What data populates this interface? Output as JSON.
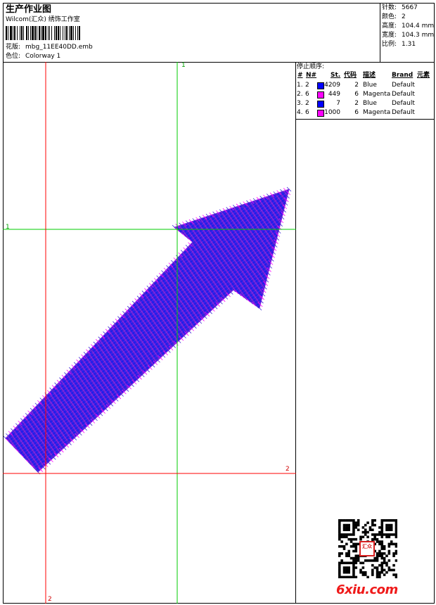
{
  "header": {
    "title": "生产作业图",
    "company": "Wilcom(汇众) 绣饰工作室",
    "design_label": "花版:",
    "design_value": "mbg_11EE40DD.emb",
    "colorway_label": "色位:",
    "colorway_value": "Colorway 1"
  },
  "stats": [
    {
      "label": "针数:",
      "value": "5667"
    },
    {
      "label": "颜色:",
      "value": "2"
    },
    {
      "label": "高度:",
      "value": "104.4 mm"
    },
    {
      "label": "宽度:",
      "value": "104.3 mm"
    },
    {
      "label": "比例:",
      "value": "1.31"
    }
  ],
  "stop_sequence": {
    "title": "停止顺序:",
    "headers": [
      "#",
      "N#",
      "St.",
      "代码",
      "描述",
      "Brand",
      "元素"
    ],
    "rows": [
      {
        "idx": "1.",
        "n": "2",
        "st": "4209",
        "code": "2",
        "desc": "Blue",
        "brand": "Default",
        "color": "#0000ff"
      },
      {
        "idx": "2.",
        "n": "6",
        "st": "449",
        "code": "6",
        "desc": "Magenta",
        "brand": "Default",
        "color": "#ff00ff"
      },
      {
        "idx": "3.",
        "n": "2",
        "st": "7",
        "code": "2",
        "desc": "Blue",
        "brand": "Default",
        "color": "#0000ff"
      },
      {
        "idx": "4.",
        "n": "6",
        "st": "1000",
        "code": "6",
        "desc": "Magenta",
        "brand": "Default",
        "color": "#ff00ff"
      }
    ]
  },
  "guides": {
    "green_top": "1",
    "green_left": "1",
    "red_right": "2",
    "red_bottom": "2"
  },
  "colors": {
    "blue": "#0000ff",
    "magenta": "#ff00ff",
    "guide_red": "#ff0000",
    "guide_green": "#00cc00",
    "fill": "#4a2cd8"
  },
  "watermark": {
    "text": "6xiu.com",
    "seal_text": "汇众"
  }
}
